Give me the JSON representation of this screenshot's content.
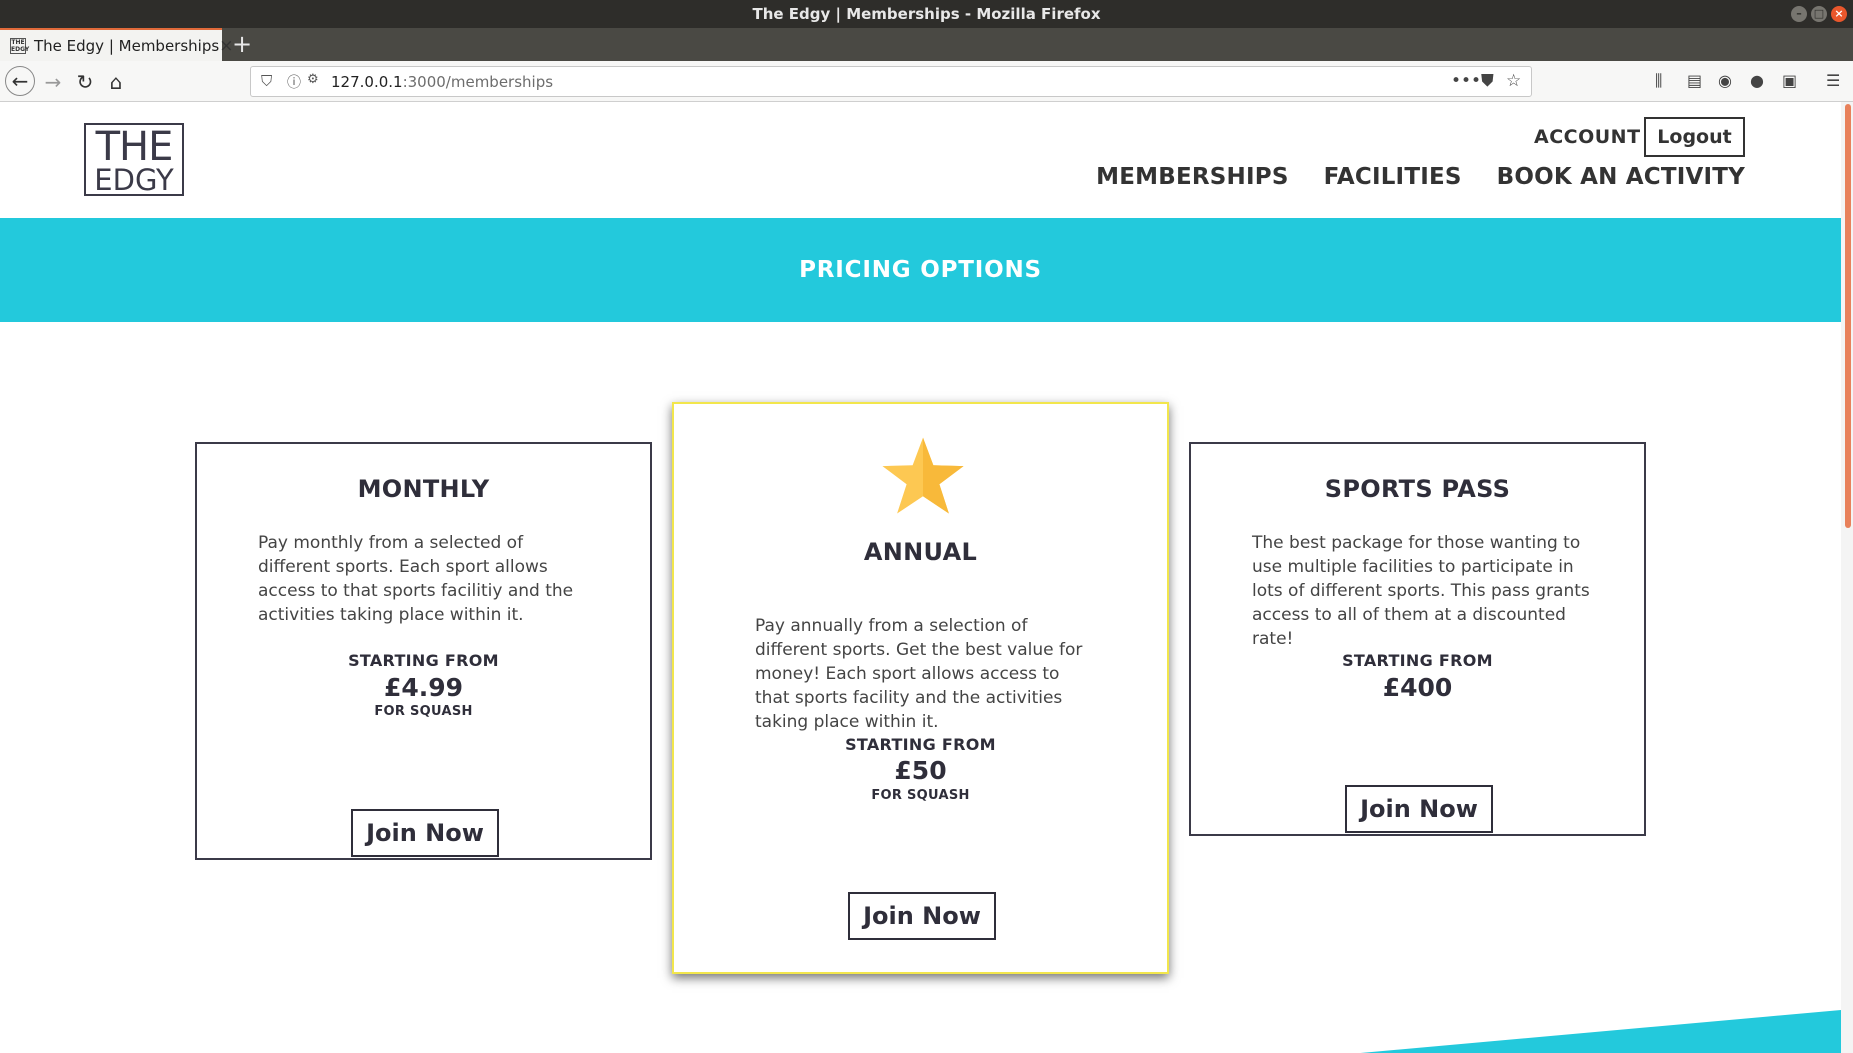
{
  "window": {
    "title": "The Edgy | Memberships - Mozilla Firefox"
  },
  "tab": {
    "title": "The Edgy | Memberships",
    "favicon_text": "THE EDGY"
  },
  "url": {
    "host": "127.0.0.1",
    "rest": ":3000/memberships"
  },
  "site": {
    "logo": {
      "line1": "THE",
      "line2": "EDGY"
    },
    "account_label": "ACCOUNT",
    "logout_label": "Logout",
    "nav": [
      "MEMBERSHIPS",
      "FACILITIES",
      "BOOK AN ACTIVITY"
    ]
  },
  "banner": {
    "title": "PRICING OPTIONS"
  },
  "cards": [
    {
      "title": "MONTHLY",
      "description": "Pay monthly from a selected of different sports. Each sport allows access to that sports facilitiy and the activities taking place within it.",
      "starting_from": "STARTING FROM",
      "price": "£4.99",
      "note": "FOR SQUASH",
      "button": "Join Now"
    },
    {
      "title": "ANNUAL",
      "description": "Pay annually from a selection of different sports. Get the best value for money! Each sport allows access to that sports facility and the activities taking place within it.",
      "starting_from": "STARTING FROM",
      "price": "£50",
      "note": "FOR SQUASH",
      "button": "Join Now",
      "featured": true,
      "icon": "star-icon"
    },
    {
      "title": "SPORTS PASS",
      "description": "The best package for those wanting to use multiple facilities to participate in lots of different sports. This pass grants access to all of them at a discounted rate!",
      "starting_from": "STARTING FROM",
      "price": "£400",
      "button": "Join Now"
    }
  ],
  "colors": {
    "banner": "#23c9dc",
    "featured_border": "#f2e64c",
    "star": "#fdc852",
    "accent": "#e06a3a"
  }
}
